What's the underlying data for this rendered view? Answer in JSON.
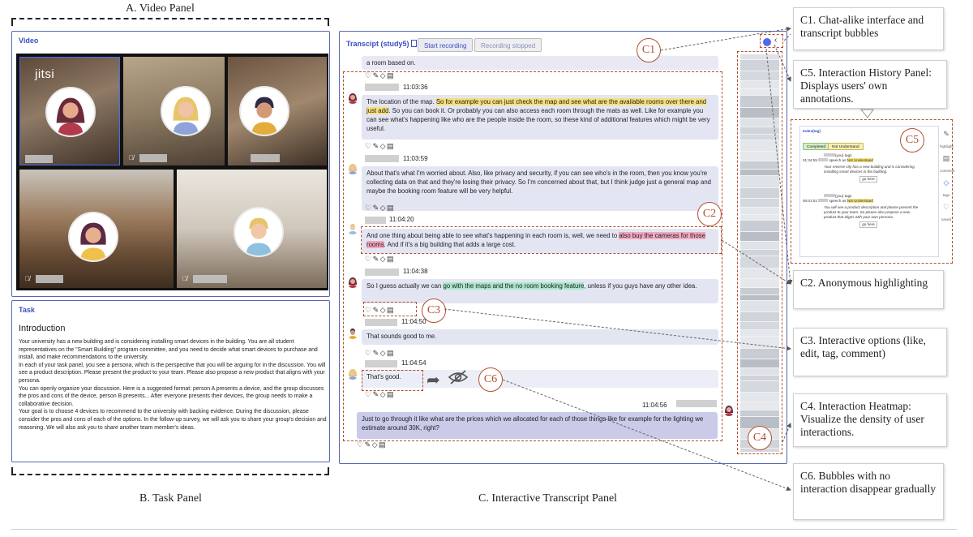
{
  "labels": {
    "video_panel": "A. Video Panel",
    "task_panel": "B. Task Panel",
    "transcript_panel": "C. Interactive Transcript Panel"
  },
  "video": {
    "title": "Video",
    "logo": "jitsi"
  },
  "task": {
    "title": "Task",
    "heading": "Introduction",
    "paragraphs": [
      "Your university has a new building and is considering installing smart devices in the building. You are all student representatives on the \"Smart Building\" program committee, and you need to decide what smart devices to purchase and install, and make recommendations to the university.",
      "In each of your task panel, you see a persona, which is the perspective that you will be arguing for in the discussion. You will see a product description. Please present the product to your team. Please also propose a new product that aligns with your persona.",
      "You can openly organize your discussion. Here is a suggested format: person A presents a device, and the group discusses the pros and cons of the device, person B presents... After everyone presents their devices, the group needs to make a collaborative decision.",
      "Your goal is to choose 4 devices to recommend to the university with backing evidence. During the discussion, please consider the pros and cons of each of the options. In the follow-up survey, we will ask you to share your group's decision and reasoning. We will also ask you to share another team member's ideas."
    ]
  },
  "transcript": {
    "title": "Transcipt (study5)",
    "start_button": "Start recording",
    "stopped_button": "Recording stopped",
    "prev_tail": "a room based on.",
    "actions": "♡✎◇▤",
    "messages": [
      {
        "time": "11:03:36",
        "pre": "The location of the map. ",
        "highlight": "So for example you can just check the map and see what are the available rooms over there and just add",
        "post": ". So you can book it. Or probably you can also access each room through the mats as well. Like for example you can see what's happening like who are the people inside the room, so these kind of additional features which might be very useful."
      },
      {
        "time": "11:03:59",
        "text": "About that's what I'm worried about. Also, like privacy and security, if you can see who's in the room, then you know you're collecting data on that and they're losing their privacy. So I'm concerned about that, but I think judge just a general map and maybe the booking room feature will be very helpful."
      },
      {
        "time": "11:04:20",
        "pre": "And one thing about being able to see what's happening in each room is, well, we need to ",
        "highlight": "also buy the cameras for those rooms",
        "post": ". And if it's a big building that adds a large cost."
      },
      {
        "time": "11:04:38",
        "pre": "So I guess actually we can ",
        "highlight": "go with the maps and the no room booking feature",
        "post": ", unless if you guys have any other idea."
      },
      {
        "time": "11:04:50",
        "text": "That sounds good to me."
      },
      {
        "time": "11:04:54",
        "text": "That's good."
      },
      {
        "time": "11:04:56",
        "text": "Just to go through it like what are the prices which we allocated for each of those things like for example for the lighting we estimate around 30K, right?"
      }
    ]
  },
  "markers": {
    "c1": "C1",
    "c2": "C2",
    "c3": "C3",
    "c4": "C4",
    "c5": "C5",
    "c6": "C6"
  },
  "callouts": {
    "c1": "C1. Chat-alike interface and transcript bubbles",
    "c5": "C5. Interaction History Panel: Displays users' own annotations.",
    "c2": "C2. Anonymous highlighting",
    "c3": "C3. Interactive options (like, edit, tag, comment)",
    "c4": "C4. Interaction Heatmap: Visualize the density of user interactions.",
    "c6": "C6. Bubbles with no interaction disappear gradually"
  },
  "history": {
    "title": "Index(tag)",
    "filter_completed": "Completed",
    "filter_not_understand": "Not Understand",
    "entries": [
      {
        "time": "01:34:55",
        "you_tags": "(you) tags",
        "speech_as": "speech as",
        "tag": "Not Understand",
        "quote": "Your reverse city has a new building and is considering installing smart devices in the building.",
        "go": "go here"
      },
      {
        "time": "00:01:01",
        "you_tags": "(you) tags",
        "speech_as": "speech as",
        "tag": "Not Understand",
        "quote": "You will see a product description and please present the product to your team. So please also propose a new product that aligns with your own persona.",
        "go": "go here"
      }
    ],
    "side": [
      "highlight",
      "comment",
      "tags",
      "saved"
    ]
  },
  "colors": {
    "panel_border": "#5866b4",
    "title_blue": "#3a50c0",
    "accent_dash": "#b0502f",
    "highlight_yellow": "#f8e07a",
    "highlight_pink": "#f3a8c0",
    "highlight_green": "#a8e8c8",
    "bubble": "#e4e5f3",
    "bubble_self": "#c9cbe9"
  }
}
